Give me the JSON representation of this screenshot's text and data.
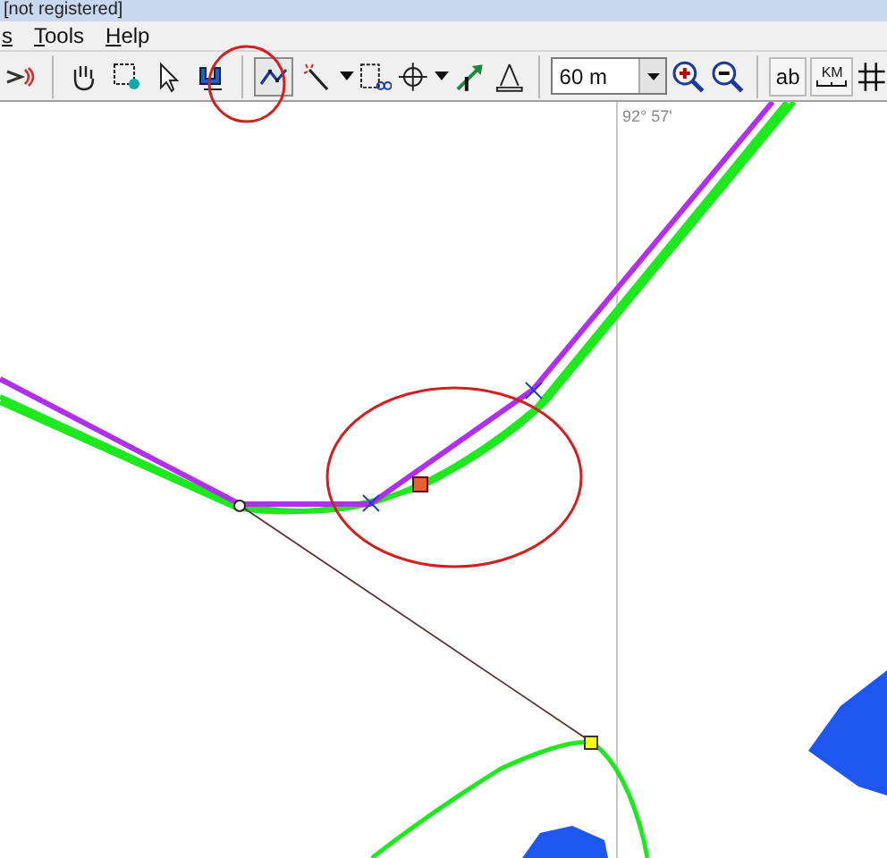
{
  "window": {
    "title": "[not registered]"
  },
  "menu": [
    {
      "label": "s"
    },
    {
      "label": "Tools"
    },
    {
      "label": "Help"
    }
  ],
  "toolbar": {
    "buttons": [
      {
        "selected": false
      },
      {
        "selected": false
      },
      {
        "selected": false
      },
      {
        "selected": false
      },
      {
        "selected": false
      },
      {
        "selected": true
      },
      {
        "selected": false
      }
    ],
    "scale": {
      "value": "60 m"
    },
    "label_button": "ab",
    "units_label": "KM"
  },
  "map": {
    "coordinate": "92° 57'"
  }
}
